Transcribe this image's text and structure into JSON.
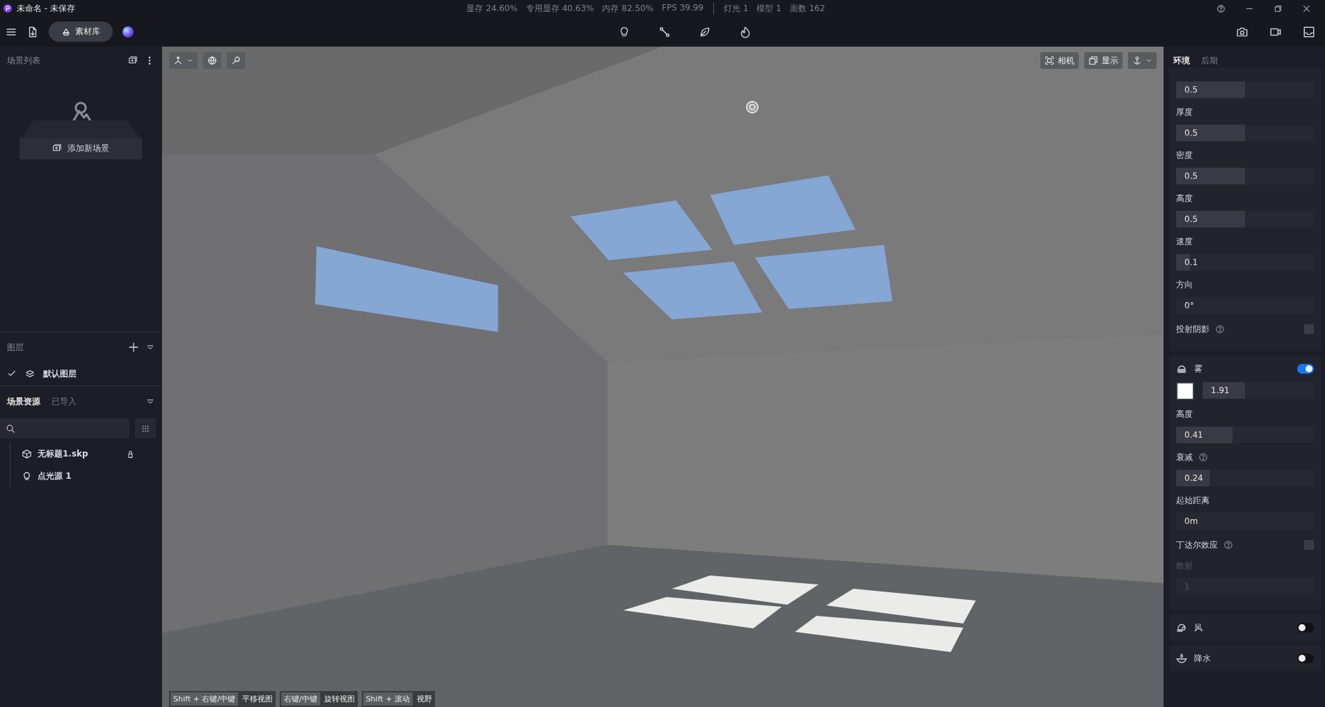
{
  "window": {
    "title": "未命名 - 未保存"
  },
  "stats": [
    "显存 24.60%",
    "专用显存 40.63%",
    "内存 82.50%",
    "FPS 39.99"
  ],
  "scene_counts": [
    "灯光 1",
    "模型 1",
    "面数 162"
  ],
  "toolbar": {
    "library_button": "素材库"
  },
  "scene_list": {
    "title": "场景列表",
    "add_button": "添加新场景"
  },
  "layers": {
    "title": "图层",
    "items": [
      {
        "name": "默认图层",
        "checked": true
      }
    ]
  },
  "assets": {
    "tabs": [
      {
        "label": "场景资源",
        "selected": true
      },
      {
        "label": "已导入",
        "selected": false
      }
    ],
    "tree": [
      {
        "name": "无标题1.skp",
        "kind": "model"
      },
      {
        "name": "点光源 1",
        "kind": "light"
      }
    ]
  },
  "viewport": {
    "buttons": [
      "相机",
      "显示"
    ],
    "hints": [
      {
        "keys": "Shift + 右键/中键",
        "action": "平移视图"
      },
      {
        "keys": "右键/中键",
        "action": "旋转视图"
      },
      {
        "keys": "Shift + 滚动",
        "action": "视野"
      }
    ]
  },
  "properties": {
    "tabs": [
      {
        "label": "环境",
        "selected": true
      },
      {
        "label": "后期",
        "selected": false
      }
    ],
    "cloud_controls": [
      {
        "kind": "slider",
        "value": "0.5",
        "level": 0.5
      },
      {
        "kind": "slider",
        "label": "厚度",
        "value": "0.5",
        "level": 0.5
      },
      {
        "kind": "slider",
        "label": "密度",
        "value": "0.5",
        "level": 0.5
      },
      {
        "kind": "slider",
        "label": "高度",
        "value": "0.5",
        "level": 0.5
      },
      {
        "kind": "slider",
        "label": "速度",
        "value": "0.1",
        "level": 0.1
      },
      {
        "kind": "field",
        "label": "方向",
        "value": "0°"
      },
      {
        "kind": "checkbox",
        "label": "投射阴影",
        "help": true,
        "checked": false
      }
    ],
    "fog": {
      "title": "雾",
      "on": true,
      "density": {
        "value": "1.91",
        "level": 0.38
      },
      "controls": [
        {
          "kind": "slider",
          "label": "高度",
          "value": "0.41",
          "level": 0.41
        },
        {
          "kind": "slider",
          "label": "衰减",
          "help": true,
          "value": "0.24",
          "level": 0.24
        },
        {
          "kind": "field",
          "label": "起始距离",
          "value": "0m"
        },
        {
          "kind": "checkbox",
          "label": "丁达尔效应",
          "help": true,
          "checked": false
        },
        {
          "kind": "field",
          "label": "散射",
          "value": "1",
          "disabled": true
        }
      ]
    },
    "sections": [
      {
        "kind": "wind",
        "title": "风",
        "on": false
      },
      {
        "kind": "rain",
        "title": "降水",
        "on": false
      }
    ]
  }
}
